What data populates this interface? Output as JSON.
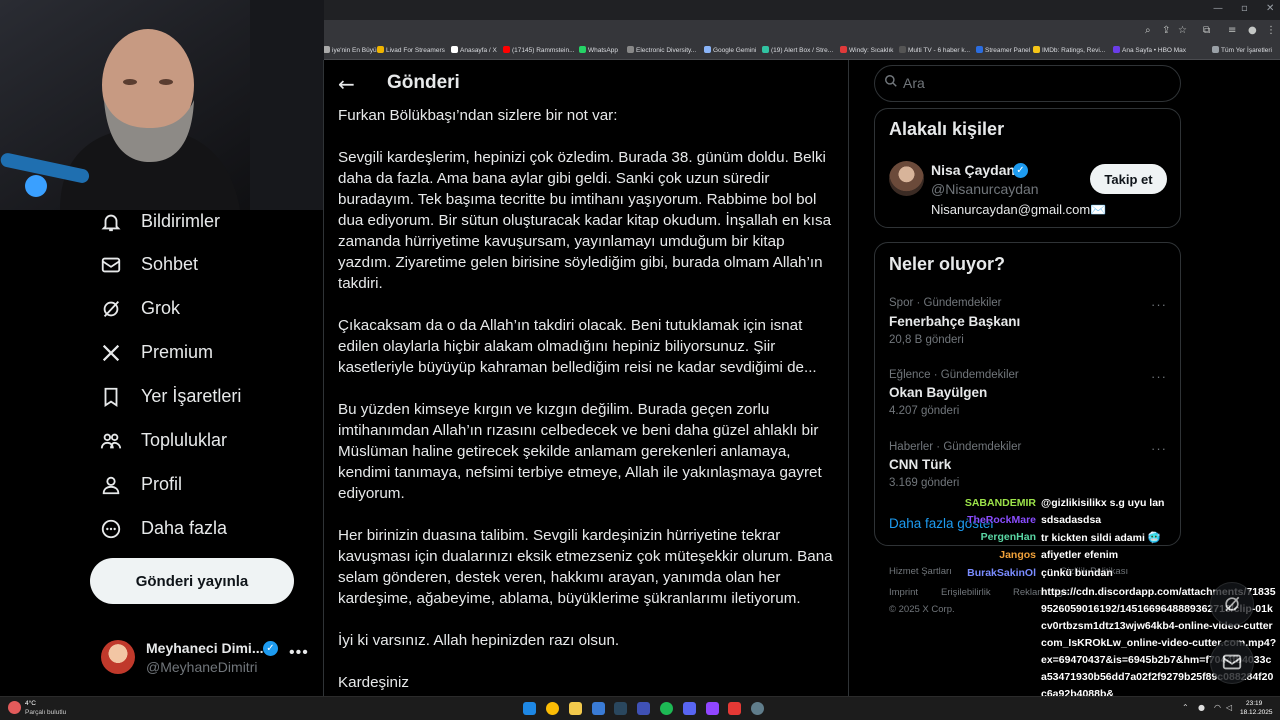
{
  "browser": {
    "bookmarks": [
      {
        "label": "iye'nin En Büyü...",
        "color": "#aaaaaa"
      },
      {
        "label": "Livad For Streamers",
        "color": "#f0b400"
      },
      {
        "label": "Anasayfa / X",
        "color": "#ffffff"
      },
      {
        "label": "(17145) Rammstein...",
        "color": "#ff0000"
      },
      {
        "label": "WhatsApp",
        "color": "#25d366"
      },
      {
        "label": "Electronic Diversity...",
        "color": "#888888"
      },
      {
        "label": "Google Gemini",
        "color": "#8ab4f8"
      },
      {
        "label": "(19) Alert Box / Stre...",
        "color": "#31c3a2"
      },
      {
        "label": "Windy: Sıcaklık",
        "color": "#e03a3a"
      },
      {
        "label": "Multi TV - 6 haber k...",
        "color": "#555555"
      },
      {
        "label": "Streamer Panel",
        "color": "#2b6de0"
      },
      {
        "label": "IMDb: Ratings, Revi...",
        "color": "#f5c518"
      },
      {
        "label": "Ana Sayfa • HBO Max",
        "color": "#6a3de8"
      },
      {
        "label": "Tüm Yer İşaretleri",
        "color": "#9aa0a6"
      }
    ]
  },
  "nav": {
    "items": [
      {
        "label": "Bildirimler",
        "icon": "bell-icon"
      },
      {
        "label": "Sohbet",
        "icon": "envelope-icon"
      },
      {
        "label": "Grok",
        "icon": "grok-icon"
      },
      {
        "label": "Premium",
        "icon": "x-logo-icon"
      },
      {
        "label": "Yer İşaretleri",
        "icon": "bookmark-icon"
      },
      {
        "label": "Topluluklar",
        "icon": "people-icon"
      },
      {
        "label": "Profil",
        "icon": "person-icon"
      },
      {
        "label": "Daha fazla",
        "icon": "more-circle-icon"
      }
    ],
    "post_button": "Gönderi yayınla",
    "account": {
      "name": "Meyhaneci Dimi...",
      "handle": "@MeyhaneDimitri"
    }
  },
  "main": {
    "header": {
      "title": "Gönderi"
    },
    "paragraphs": [
      "Furkan Bölükbaşı’ndan sizlere bir not var:",
      "Sevgili kardeşlerim, hepinizi çok özledim. Burada 38. günüm doldu. Belki daha da fazla. Ama bana aylar gibi geldi. Sanki çok uzun süredir buradayım. Tek başıma tecritte bu imtihanı yaşıyorum. Rabbime bol bol dua ediyorum. Bir sütun oluşturacak kadar kitap okudum. İnşallah en kısa zamanda hürriyetime kavuşursam, yayınlamayı umduğum bir kitap yazdım. Ziyaretime gelen birisine söylediğim gibi, burada olmam Allah’ın takdiri.",
      "Çıkacaksam da o da Allah’ın takdiri olacak. Beni tutuklamak için isnat edilen olaylarla hiçbir alakam olmadığını hepiniz biliyorsunuz. Şiir kasetleriyle büyüyüp kahraman bellediğim reisi ne kadar sevdiğimi de...",
      "Bu yüzden kimseye kırgın ve kızgın değilim. Burada geçen zorlu imtihanımdan Allah’ın rızasını celbedecek ve beni daha güzel ahlaklı bir Müslüman haline getirecek şekilde anlamam gerekenleri anlamaya, kendimi tanımaya, nefsimi terbiye etmeye, Allah ile yakınlaşmaya gayret ediyorum.",
      "Her birinizin duasına talibim. Sevgili kardeşinizin hürriyetine tekrar kavuşması için dualarınızı eksik etmezseniz çok müteşekkir olurum. Bana selam gönderen, destek veren, hakkımı arayan, yanımda olan her kardeşime, ağabeyime, ablama, büyüklerime şükranlarımı iletiyorum.",
      "İyi ki varsınız. Allah hepinizden razı olsun.",
      "Kardeşiniz"
    ]
  },
  "sidebar": {
    "search_placeholder": "Ara",
    "related": {
      "title": "Alakalı kişiler",
      "person": {
        "name": "Nisa Çaydan",
        "handle": "@Nisanurcaydan",
        "bio": "Nisanurcaydan@gmail.com✉️",
        "follow_label": "Takip et"
      }
    },
    "trends": {
      "title": "Neler oluyor?",
      "items": [
        {
          "meta": "Spor · Gündemdekiler",
          "name": "Fenerbahçe Başkanı",
          "count": "20,8 B gönderi"
        },
        {
          "meta": "Eğlence · Gündemdekiler",
          "name": "Okan Bayülgen",
          "count": "4.207 gönderi"
        },
        {
          "meta": "Haberler · Gündemdekiler",
          "name": "CNN Türk",
          "count": "3.169 gönderi"
        }
      ],
      "show_more": "Daha fazla göster"
    },
    "footer": {
      "links": [
        "Hizmet Şartları",
        "Gizlilik Politikası",
        "Imprint",
        "Erişilebilirlik",
        "Reklam bilgisi"
      ],
      "copyright": "© 2025 X Corp."
    }
  },
  "chat": {
    "messages": [
      {
        "user": "SABANDEMIR",
        "color": "#9ce34a",
        "text": "@gizlikisilikx s.g uyu lan"
      },
      {
        "user": "TheRockMare",
        "color": "#8a4dff",
        "text": "sdsadasdsa"
      },
      {
        "user": "PergenHan",
        "color": "#5ad6a4",
        "text": "tr kickten sildi adami 🥶"
      },
      {
        "user": "Jangos",
        "color": "#f0a13a",
        "text": "afiyetler efenim"
      },
      {
        "user": "BurakSakinOl",
        "color": "#7a8cff",
        "text": "çünkü bundan"
      }
    ],
    "url_message": "https://cdn.discordapp.com/attachments/718359526059016192/1451669648889362718/clip-01kcv0rtbzsm1dtz13wjw64kb4-online-video-cuttercom_IsKROkLw_online-video-cutter.com.mp4?ex=69470437&is=6945b2b7&hm=f7044fb4033ca53471930b56dd7a02f2f9279b25f89c088284f20c6a92b4088b&"
  },
  "taskbar": {
    "weather_temp": "4°C",
    "weather_condition": "Parçalı bulutlu",
    "time": "23:19",
    "date": "18.12.2025"
  }
}
